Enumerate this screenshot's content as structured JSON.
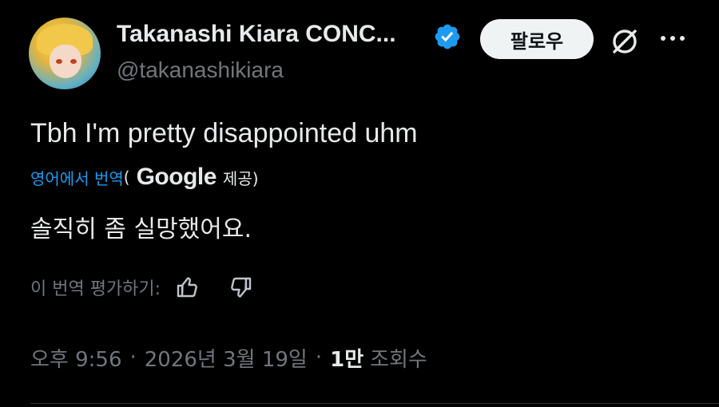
{
  "author": {
    "display_name": "Takanashi Kiara CONC...",
    "handle": "@takanashikiara",
    "verified": true
  },
  "actions": {
    "follow_label": "팔로우"
  },
  "tweet": {
    "text": "Tbh I'm pretty disappointed uhm",
    "translation": {
      "link_label": "영어에서 번역",
      "open_paren": "(",
      "provider": "Google",
      "provided_label": "제공)",
      "translated_text": "솔직히 좀 실망했어요."
    },
    "rate_label": "이 번역 평가하기:",
    "time": "오후 9:56",
    "date": "2026년 3월 19일",
    "separator": "·",
    "views_count": "1만",
    "views_label": "조회수"
  },
  "colors": {
    "background": "#000000",
    "text": "#e7e9ea",
    "muted": "#71767b",
    "link": "#1d9bf0",
    "verified": "#1d9bf0",
    "button_bg": "#eff3f4"
  },
  "icons": [
    "verified-badge-icon",
    "grok-icon",
    "more-icon",
    "thumbs-up-icon",
    "thumbs-down-icon"
  ]
}
